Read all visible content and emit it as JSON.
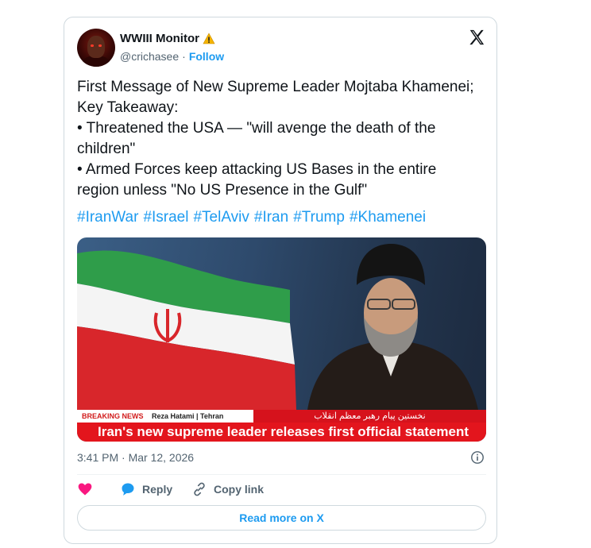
{
  "author": {
    "name": "WWIII Monitor",
    "name_icon": "warning-icon",
    "handle": "@crichasee",
    "separator": "·",
    "follow_label": "Follow"
  },
  "tweet": {
    "lines": [
      "First Message of New Supreme Leader Mojtaba Khamenei;",
      "Key Takeaway:",
      "• Threatened the USA — \"will avenge the death of the",
      "children\"",
      "• Armed Forces keep attacking US Bases in the entire",
      "region unless \"No US Presence in the Gulf\""
    ],
    "hashtags": [
      "#IranWar",
      "#Israel",
      "#TelAviv",
      "#Iran",
      "#Trump",
      "#Khamenei"
    ]
  },
  "media": {
    "breaking_label": "BREAKING NEWS",
    "reporter": "Reza Hatami | Tehran",
    "persian_text": "نخستین پیام رهبر معظم انقلاب",
    "headline": "Iran's new supreme leader releases first official statement"
  },
  "timestamp": "3:41 PM · Mar 12, 2026",
  "actions": {
    "like_icon": "heart-icon",
    "reply_label": "Reply",
    "copy_label": "Copy link"
  },
  "read_more_label": "Read more on X",
  "colors": {
    "accent": "#1d9bf0",
    "like": "#f91880",
    "breaking_red": "#e3151d"
  }
}
